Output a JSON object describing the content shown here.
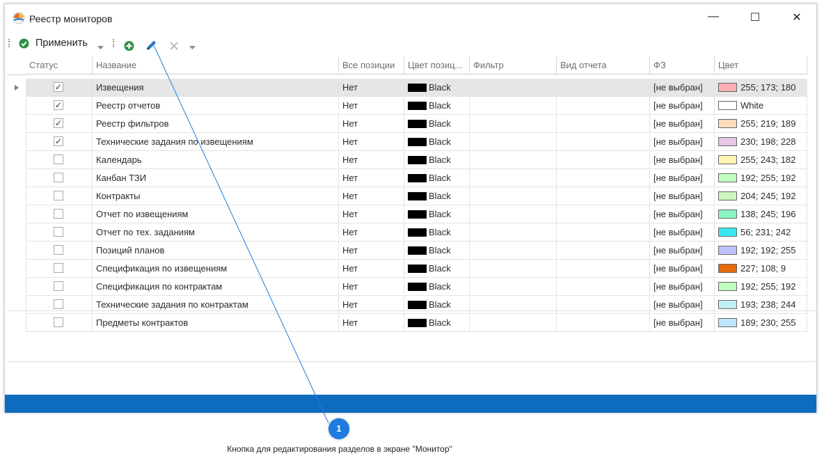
{
  "window": {
    "title": "Реестр мониторов",
    "minimize": "—",
    "maximize": "☐",
    "close": "✕"
  },
  "toolbar": {
    "apply_label": "Применить"
  },
  "columns": [
    "Статус",
    "Название",
    "Все позиции",
    "Цвет позиц...",
    "Фильтр",
    "Вид отчета",
    "ФЗ",
    "Цвет"
  ],
  "rows": [
    {
      "checked": true,
      "name": "Извещения",
      "all_positions": "Нет",
      "pos_color": "Black",
      "fz": "[не выбран]",
      "color_label": "255; 173; 180",
      "color_hex": "#ffadb4"
    },
    {
      "checked": true,
      "name": "Реестр отчетов",
      "all_positions": "Нет",
      "pos_color": "Black",
      "fz": "[не выбран]",
      "color_label": "White",
      "color_hex": "#ffffff"
    },
    {
      "checked": true,
      "name": "Реестр фильтров",
      "all_positions": "Нет",
      "pos_color": "Black",
      "fz": "[не выбран]",
      "color_label": "255; 219; 189",
      "color_hex": "#ffdbbd"
    },
    {
      "checked": true,
      "name": "Технические задания по извещениям",
      "all_positions": "Нет",
      "pos_color": "Black",
      "fz": "[не выбран]",
      "color_label": "230; 198; 228",
      "color_hex": "#e6c6e4"
    },
    {
      "checked": false,
      "name": "Календарь",
      "all_positions": "Нет",
      "pos_color": "Black",
      "fz": "[не выбран]",
      "color_label": "255; 243; 182",
      "color_hex": "#fff3b6"
    },
    {
      "checked": false,
      "name": "Канбан ТЗИ",
      "all_positions": "Нет",
      "pos_color": "Black",
      "fz": "[не выбран]",
      "color_label": "192; 255; 192",
      "color_hex": "#c0ffc0"
    },
    {
      "checked": false,
      "name": "Контракты",
      "all_positions": "Нет",
      "pos_color": "Black",
      "fz": "[не выбран]",
      "color_label": "204; 245; 192",
      "color_hex": "#ccf5c0"
    },
    {
      "checked": false,
      "name": "Отчет по извещениям",
      "all_positions": "Нет",
      "pos_color": "Black",
      "fz": "[не выбран]",
      "color_label": "138; 245; 196",
      "color_hex": "#8af5c4"
    },
    {
      "checked": false,
      "name": "Отчет по тех. заданиям",
      "all_positions": "Нет",
      "pos_color": "Black",
      "fz": "[не выбран]",
      "color_label": "56; 231; 242",
      "color_hex": "#38e7f2"
    },
    {
      "checked": false,
      "name": "Позиций планов",
      "all_positions": "Нет",
      "pos_color": "Black",
      "fz": "[не выбран]",
      "color_label": "192; 192; 255",
      "color_hex": "#c0c0ff"
    },
    {
      "checked": false,
      "name": "Спецификация по извещениям",
      "all_positions": "Нет",
      "pos_color": "Black",
      "fz": "[не выбран]",
      "color_label": "227; 108; 9",
      "color_hex": "#e36c09"
    },
    {
      "checked": false,
      "name": "Спецификация по контрактам",
      "all_positions": "Нет",
      "pos_color": "Black",
      "fz": "[не выбран]",
      "color_label": "192; 255; 192",
      "color_hex": "#c0ffc0"
    },
    {
      "checked": false,
      "name": "Технические задания по контрактам",
      "all_positions": "Нет",
      "pos_color": "Black",
      "fz": "[не выбран]",
      "color_label": "193; 238; 244",
      "color_hex": "#c1eef4"
    },
    {
      "checked": false,
      "name": "Предметы контрактов",
      "all_positions": "Нет",
      "pos_color": "Black",
      "fz": "[не выбран]",
      "color_label": "189; 230; 255",
      "color_hex": "#bde6ff"
    }
  ],
  "callout": {
    "number": "1",
    "text": "Кнопка для редактирования разделов в экране \"Монитор\""
  },
  "colors": {
    "statusbar": "#0e6cbf",
    "callout_badge": "#1e7be0",
    "apply_icon": "#2f8f3f",
    "edit_icon": "#2a73c6"
  }
}
